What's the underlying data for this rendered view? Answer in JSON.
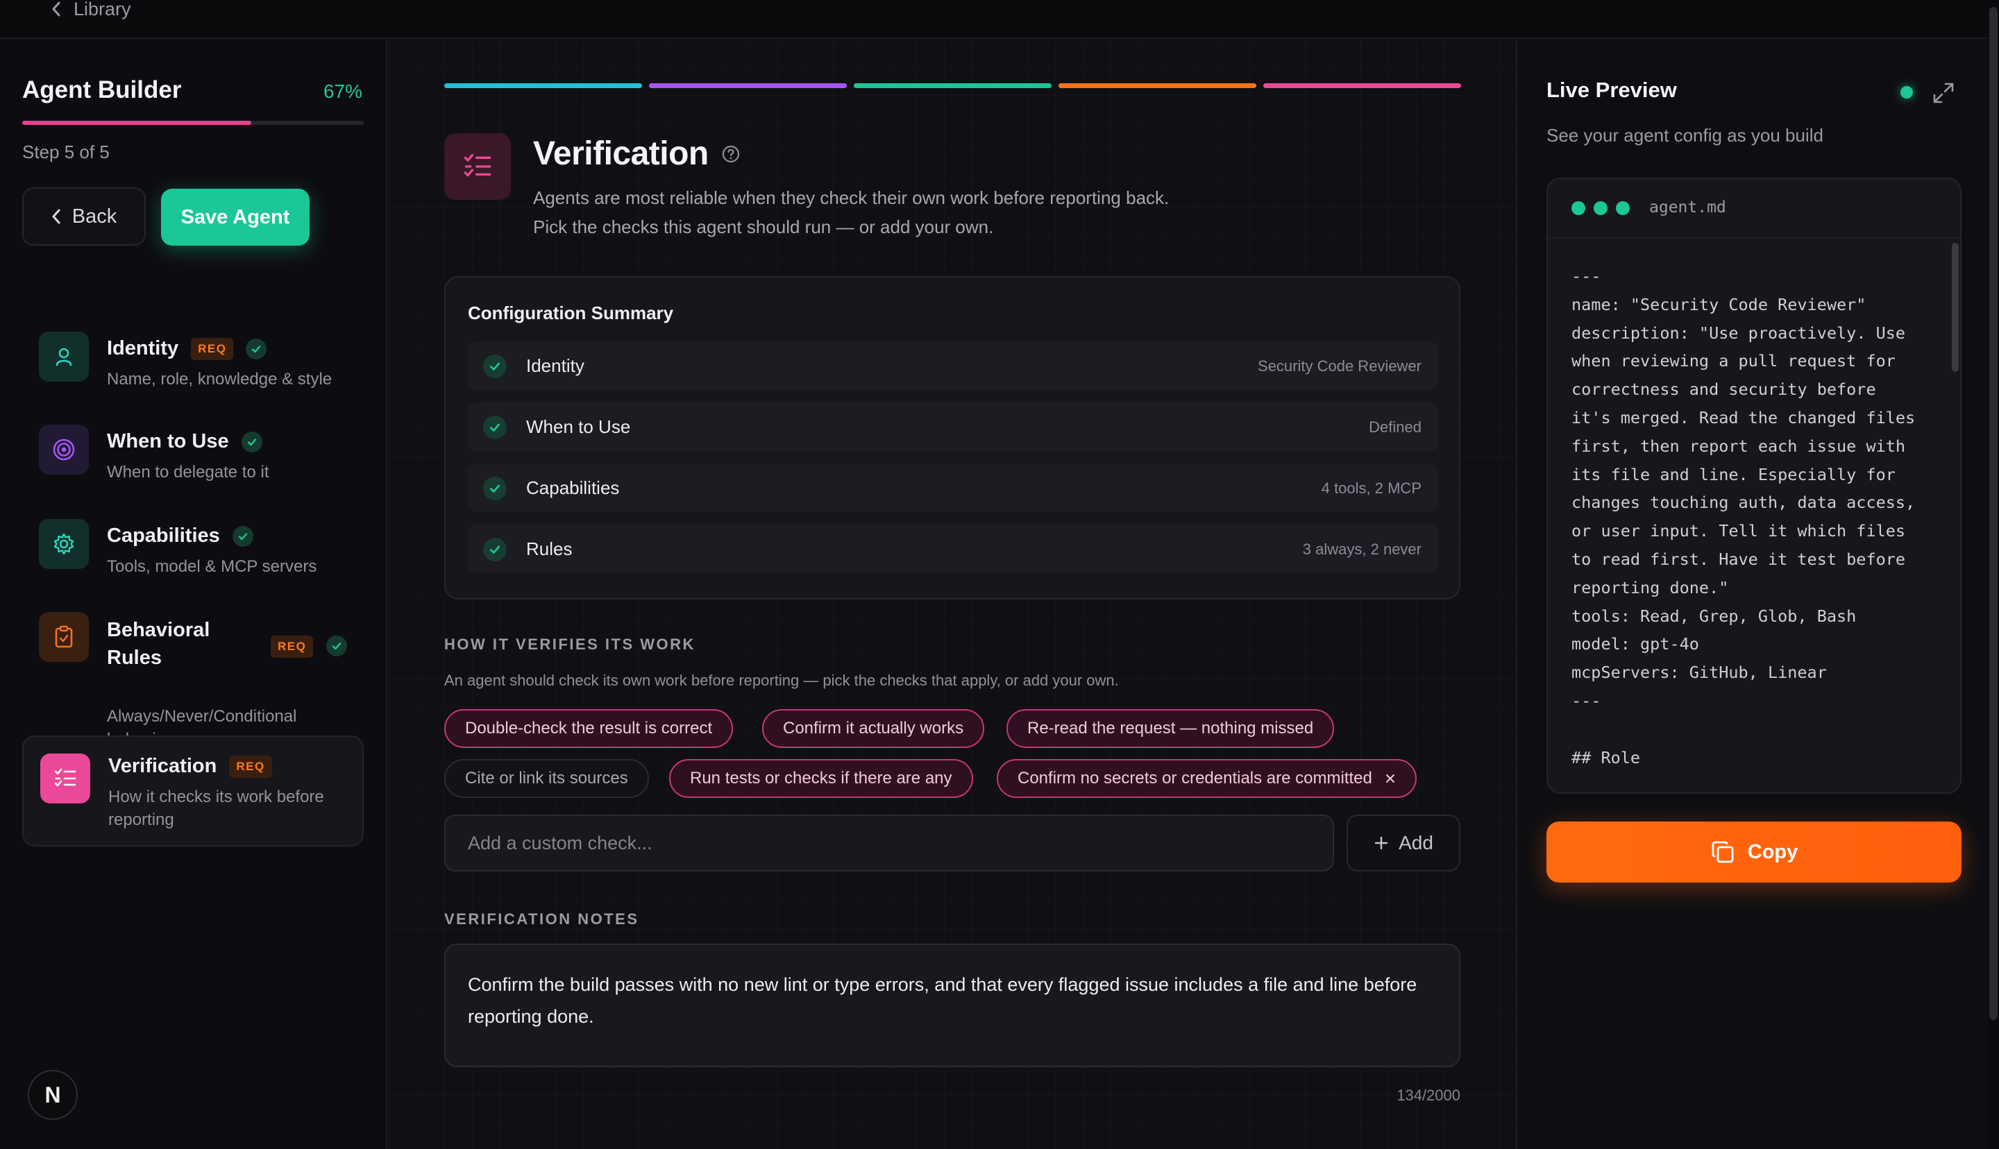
{
  "topbar": {
    "back_label": "Library"
  },
  "sidebar": {
    "title": "Agent Builder",
    "progress_percent_label": "67%",
    "progress_fraction": 0.67,
    "step_label": "Step 5 of 5",
    "back_label": "Back",
    "save_label": "Save Agent",
    "req_label": "REQ",
    "items": [
      {
        "title": "Identity",
        "subtitle": "Name, role, knowledge & style",
        "required": true,
        "complete": true,
        "icon": "user-icon",
        "accent": "#2dd4bf"
      },
      {
        "title": "When to Use",
        "subtitle": "When to delegate to it",
        "required": false,
        "complete": true,
        "icon": "target-icon",
        "accent": "#a855f7"
      },
      {
        "title": "Capabilities",
        "subtitle": "Tools, model & MCP servers",
        "required": false,
        "complete": true,
        "icon": "gear-icon",
        "accent": "#2dd4bf"
      },
      {
        "title_line1": "Behavioral",
        "title_line2": "Rules",
        "subtitle_line1": "Always/Never/Conditional",
        "subtitle_line2": "behaviors",
        "required": true,
        "complete": true,
        "icon": "clipboard-icon",
        "accent": "#f97316"
      },
      {
        "title": "Verification",
        "subtitle_line1": "How it checks its work before",
        "subtitle_line2": "reporting",
        "required": true,
        "active": true,
        "icon": "checklist-icon",
        "accent": "#ec4899"
      }
    ],
    "logo_letter": "N"
  },
  "main": {
    "progress_colors": [
      "#22c3d6",
      "#a855f7",
      "#1bc796",
      "#f97316",
      "#ec4899"
    ],
    "title": "Verification",
    "description_line1": "Agents are most reliable when they check their own work before reporting back.",
    "description_line2": "Pick the checks this agent should run — or add your own.",
    "summary": {
      "title": "Configuration Summary",
      "rows": [
        {
          "label": "Identity",
          "value": "Security Code Reviewer"
        },
        {
          "label": "When to Use",
          "value": "Defined"
        },
        {
          "label": "Capabilities",
          "value": "4 tools, 2 MCP"
        },
        {
          "label": "Rules",
          "value": "3 always, 2 never"
        }
      ]
    },
    "checks_heading": "HOW IT VERIFIES ITS WORK",
    "checks_help": "An agent should check its own work before reporting — pick the checks that apply, or add your own.",
    "checks": [
      {
        "label": "Double-check the result is correct",
        "selected": true
      },
      {
        "label": "Confirm it actually works",
        "selected": true
      },
      {
        "label": "Re-read the request — nothing missed",
        "selected": true
      },
      {
        "label": "Cite or link its sources",
        "selected": false
      },
      {
        "label": "Run tests or checks if there are any",
        "selected": true
      },
      {
        "label": "Confirm no secrets or credentials are committed",
        "selected": true,
        "removable": true
      }
    ],
    "custom_placeholder": "Add a custom check...",
    "add_label": "Add",
    "notes_heading": "VERIFICATION NOTES",
    "notes_value": "Confirm the build passes with no new lint or type errors, and that every flagged issue includes a file and line before reporting done.",
    "notes_count": "134/2000"
  },
  "preview": {
    "title": "Live Preview",
    "subtitle": "See your agent config as you build",
    "filename": "agent.md",
    "code_lines": [
      "---",
      "name: \"Security Code Reviewer\"",
      "description: \"Use proactively. Use",
      "when reviewing a pull request for",
      "correctness and security before",
      "it's merged. Read the changed files",
      "first, then report each issue with",
      "its file and line. Especially for",
      "changes touching auth, data access,",
      "or user input. Tell it which files",
      "to read first. Have it test before",
      "reporting done.\"",
      "tools: Read, Grep, Glob, Bash",
      "model: gpt-4o",
      "mcpServers: GitHub, Linear",
      "---",
      "",
      "## Role"
    ],
    "copy_label": "Copy"
  }
}
